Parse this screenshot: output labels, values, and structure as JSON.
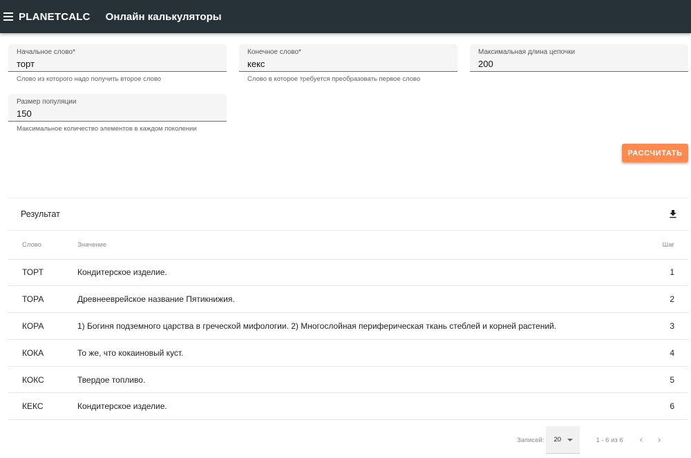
{
  "appbar": {
    "brand": "PLANETCALC",
    "subtitle": "Онлайн калькуляторы"
  },
  "form": {
    "start_word": {
      "label": "Начальное слово*",
      "value": "торт",
      "hint": "Слово из которого надо получить второе слово"
    },
    "end_word": {
      "label": "Конечное слово*",
      "value": "кекс",
      "hint": "Слово в которое требуется преобразовать первое слово"
    },
    "max_chain": {
      "label": "Максимальная длина цепочки",
      "value": "200"
    },
    "population": {
      "label": "Размер популяции",
      "value": "150",
      "hint": "Максимальное количество элементов в каждом поколении"
    },
    "calculate_label": "РАССЧИТАТЬ"
  },
  "result": {
    "title": "Результат",
    "columns": {
      "word": "Слово",
      "value": "Значение",
      "step": "Шаг"
    },
    "rows": [
      {
        "word": "ТОРТ",
        "value": "Кондитерское изделие.",
        "step": "1"
      },
      {
        "word": "ТОРА",
        "value": "Древнееврейское название Пятикнижия.",
        "step": "2"
      },
      {
        "word": "КОРА",
        "value": "1) Богиня подземного царства в греческой мифологии. 2) Многослойная периферическая ткань стеблей и корней растений.",
        "step": "3"
      },
      {
        "word": "КОКА",
        "value": "То же, что кокаиновый куст.",
        "step": "4"
      },
      {
        "word": "КОКС",
        "value": "Твердое топливо.",
        "step": "5"
      },
      {
        "word": "КЕКС",
        "value": "Кондитерское изделие.",
        "step": "6"
      }
    ]
  },
  "pagination": {
    "rows_per_page_label": "Записей:",
    "rows_per_page": "20",
    "range": "1 - 6 из 6"
  },
  "colors": {
    "appbar": "#263238",
    "accent": "#ff8a50"
  },
  "icons": {
    "menu": "menu-icon",
    "download": "download-icon",
    "dropdown": "chevron-down-icon",
    "prev": "chevron-left-icon",
    "next": "chevron-right-icon"
  }
}
